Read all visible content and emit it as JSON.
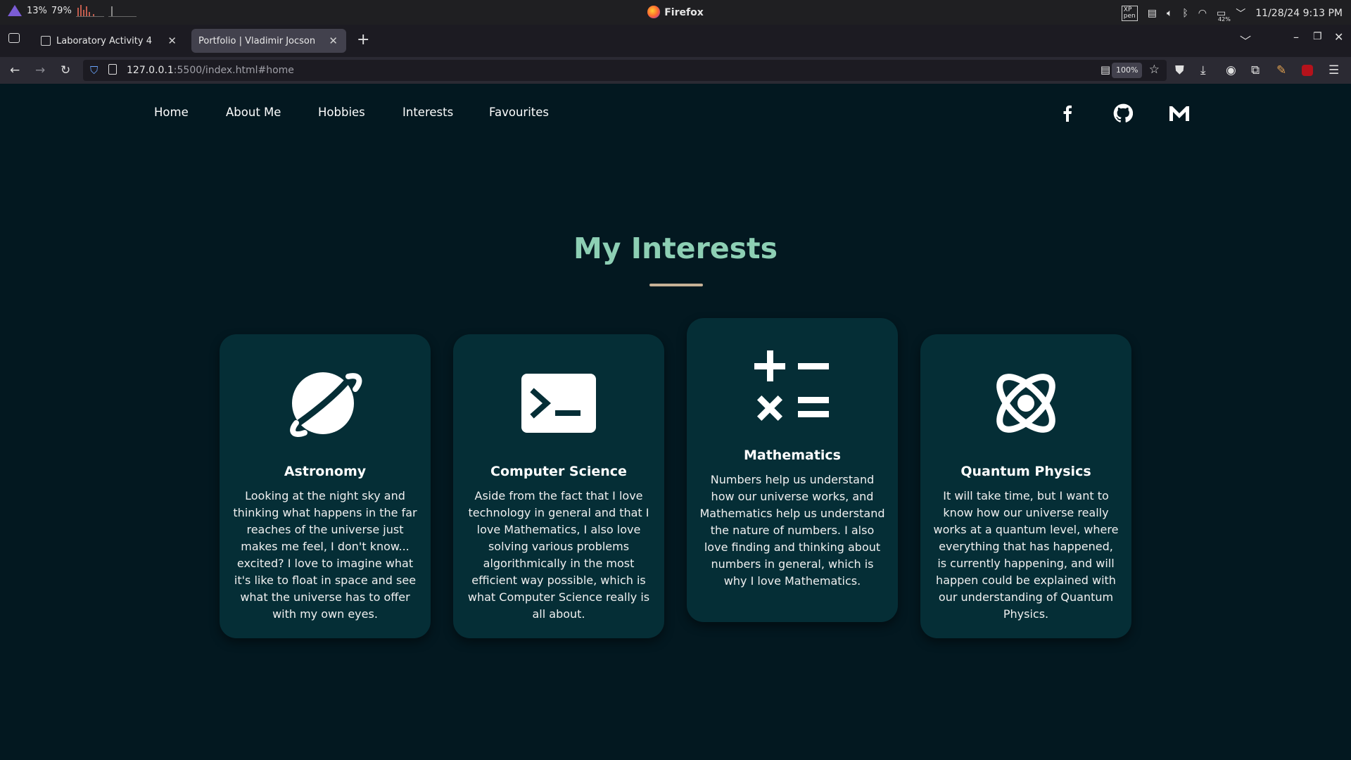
{
  "system": {
    "cpu": "13%",
    "mem": "79%",
    "app_title": "Firefox",
    "datetime": "11/28/24 9:13 PM",
    "battery": "42%"
  },
  "tabs": [
    {
      "label": "Laboratory Activity 4",
      "active": false
    },
    {
      "label": "Portfolio | Vladimir Jocson",
      "active": true
    }
  ],
  "url": {
    "host": "127.0.0.1",
    "rest": ":5500/index.html#home"
  },
  "zoom": "100%",
  "site_nav": [
    "Home",
    "About Me",
    "Hobbies",
    "Interests",
    "Favourites"
  ],
  "social_icons": [
    "facebook-icon",
    "github-icon",
    "gmail-icon"
  ],
  "section": {
    "title": "My Interests"
  },
  "cards": [
    {
      "icon": "planet-icon",
      "title": "Astronomy",
      "text": "Looking at the night sky and thinking what happens in the far reaches of the universe just makes me feel, I don't know... excited? I love to imagine what it's like to float in space and see what the universe has to offer with my own eyes."
    },
    {
      "icon": "terminal-icon",
      "title": "Computer Science",
      "text": "Aside from the fact that I love technology in general and that I love Mathematics, I also love solving various problems algorithmically in the most efficient way possible, which is what Computer Science really is all about."
    },
    {
      "icon": "calculator-symbols-icon",
      "title": "Mathematics",
      "text": "Numbers help us understand how our universe works, and Mathematics help us understand the nature of numbers. I also love finding and thinking about numbers in general, which is why I love Mathematics."
    },
    {
      "icon": "atom-icon",
      "title": "Quantum Physics",
      "text": "It will take time, but I want to know how our universe really works at a quantum level, where everything that has happened, is currently happening, and will happen could be explained with our understanding of Quantum Physics."
    }
  ],
  "colors": {
    "page_bg": "#031820",
    "card_bg": "#052e36",
    "heading": "#8dcfb4",
    "accent": "#c7b196"
  }
}
